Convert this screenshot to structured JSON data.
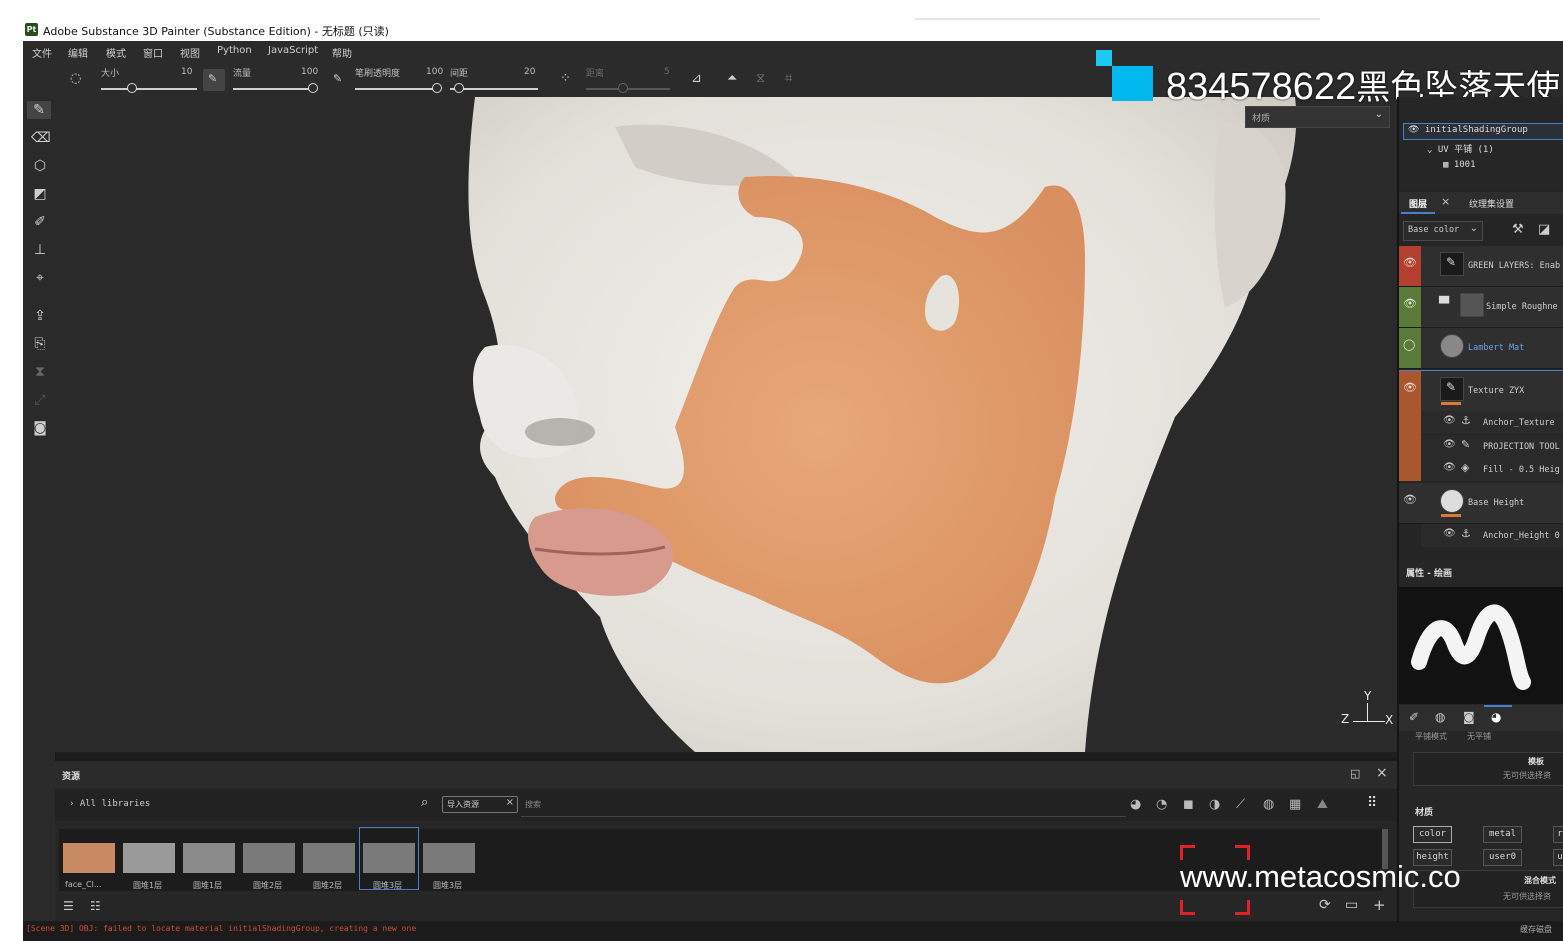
{
  "app": {
    "title": "Adobe Substance 3D Painter (Substance Edition) - 无标题 (只读)",
    "logo": "Pt"
  },
  "menu": [
    "文件",
    "编辑",
    "模式",
    "窗口",
    "视图",
    "Python",
    "JavaScript",
    "帮助"
  ],
  "tool_options": {
    "size_label": "大小",
    "size_value": "10",
    "flow_label": "流量",
    "flow_value": "100",
    "opacity_label": "笔刷透明度",
    "opacity_value": "100",
    "spacing_label": "间距",
    "spacing_value": "20",
    "angle_label": "距离",
    "angle_value": "5"
  },
  "watermark": {
    "qq": "834578622",
    "name": "黑色坠落天使",
    "site": "www.metacosmic.co"
  },
  "texture_set": {
    "material_dropdown": "材质",
    "shading_group": "initialShadingGroup",
    "uv_label": "UV 平铺 (1)",
    "tile": "1001"
  },
  "layers_panel": {
    "tab_layers": "图层",
    "tab_settings": "纹理集设置",
    "channel_select": "Base color",
    "layers": [
      {
        "name": "GREEN LAYERS: Enab",
        "color": "#b3402f"
      },
      {
        "name": "Simple Roughne",
        "color": "#5a7a3a"
      },
      {
        "name": "Lambert Mat",
        "color": "#5a7a3a"
      },
      {
        "name": "Texture ZYX",
        "color": "#a9582d"
      },
      {
        "name": "Base Height",
        "color": "#2f2f2f"
      }
    ],
    "sublayers": [
      "Anchor_Texture",
      "PROJECTION TOOL",
      "Fill - 0.5 Heig"
    ],
    "base_height_sub": "Anchor_Height 0"
  },
  "properties": {
    "title": "属性 - 绘画",
    "mode_label": "平铺模式",
    "mode_value": "无平铺",
    "stencil_title": "模板",
    "stencil_empty": "无可供选择资",
    "material_title": "材质",
    "channels": [
      "color",
      "metal",
      "r",
      "height",
      "user0",
      "u"
    ],
    "blend_label": "混合模式",
    "blend_empty": "无可供选择资",
    "cache_label": "缓存磁盘"
  },
  "assets": {
    "title": "资源",
    "library": "All libraries",
    "search_tag": "导入资源",
    "search_placeholder": "搜索",
    "items": [
      "face_Cl...",
      "圆堆1层",
      "圆堆1层",
      "圆堆2层",
      "圆堆2层",
      "圆堆3层",
      "圆堆3层"
    ]
  },
  "status": {
    "error": "[Scene 3D] OBJ: failed to locate material initialShadingGroup, creating a new one"
  },
  "viewport": {
    "axis_y": "Y",
    "axis_x": "X",
    "axis_z": "Z",
    "skin_color": "#e2a373",
    "model_color": "#e8e6e1"
  }
}
